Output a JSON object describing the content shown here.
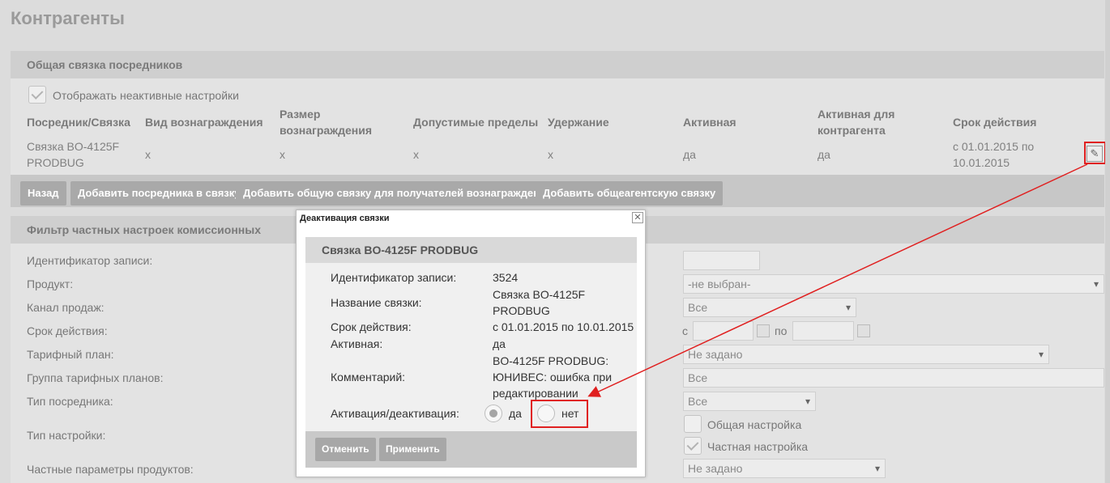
{
  "page_title": "Контрагенты",
  "section1": {
    "header": "Общая связка посредников",
    "show_inactive_label": "Отображать неактивные настройки",
    "columns": [
      "Посредник/Связка",
      "Вид вознаграждения",
      "Размер вознаграждения",
      "Допустимые пределы",
      "Удержание",
      "Активная",
      "Активная для контрагента",
      "Срок действия"
    ],
    "row": [
      "Связка BO-4125F PRODBUG",
      "x",
      "x",
      "x",
      "x",
      "да",
      "да",
      "с 01.01.2015 по 10.01.2015"
    ],
    "buttons": {
      "back": "Назад",
      "add_intermediary": "Добавить посредника в связку",
      "add_common": "Добавить общую связку для получателей вознаграждения",
      "add_agency": "Добавить общеагентскую связку"
    }
  },
  "section2": {
    "header": "Фильтр частных настроек комиссионных",
    "labels": {
      "record_id": "Идентификатор записи:",
      "product": "Продукт:",
      "channel": "Канал продаж:",
      "period": "Срок действия:",
      "tariff": "Тарифный план:",
      "tariff_group": "Группа тарифных планов:",
      "intermediary_type": "Тип посредника:",
      "setting_type": "Тип настройки:",
      "product_params": "Частные параметры продуктов:"
    },
    "values": {
      "record_id": "",
      "product": "-не выбран-",
      "channel": "Все",
      "period_from_label": "с",
      "period_to_label": "по",
      "tariff": "Не задано",
      "tariff_group": "Все",
      "intermediary_type": "Все",
      "setting_common": "Общая настройка",
      "setting_private": "Частная настройка",
      "product_params": "Не задано"
    }
  },
  "modal": {
    "title": "Деактивация связки",
    "heading": "Связка BO-4125F PRODBUG",
    "fields": {
      "record_id_label": "Идентификатор записи:",
      "record_id": "3524",
      "name_label": "Название связки:",
      "name_line1": "Связка BO-4125F",
      "name_line2": "PRODBUG",
      "period_label": "Срок действия:",
      "period": "с 01.01.2015 по 10.01.2015",
      "active_label": "Активная:",
      "active": "да",
      "comment_label": "Комментарий:",
      "comment_line1": "BO-4125F PRODBUG:",
      "comment_line2": "ЮНИВЕС: ошибка при",
      "comment_line3": "редактировании",
      "toggle_label": "Активация/деактивация:",
      "yes": "да",
      "no": "нет"
    },
    "buttons": {
      "cancel": "Отменить",
      "apply": "Применить"
    }
  },
  "colors": {
    "annotation": "#e02020"
  }
}
